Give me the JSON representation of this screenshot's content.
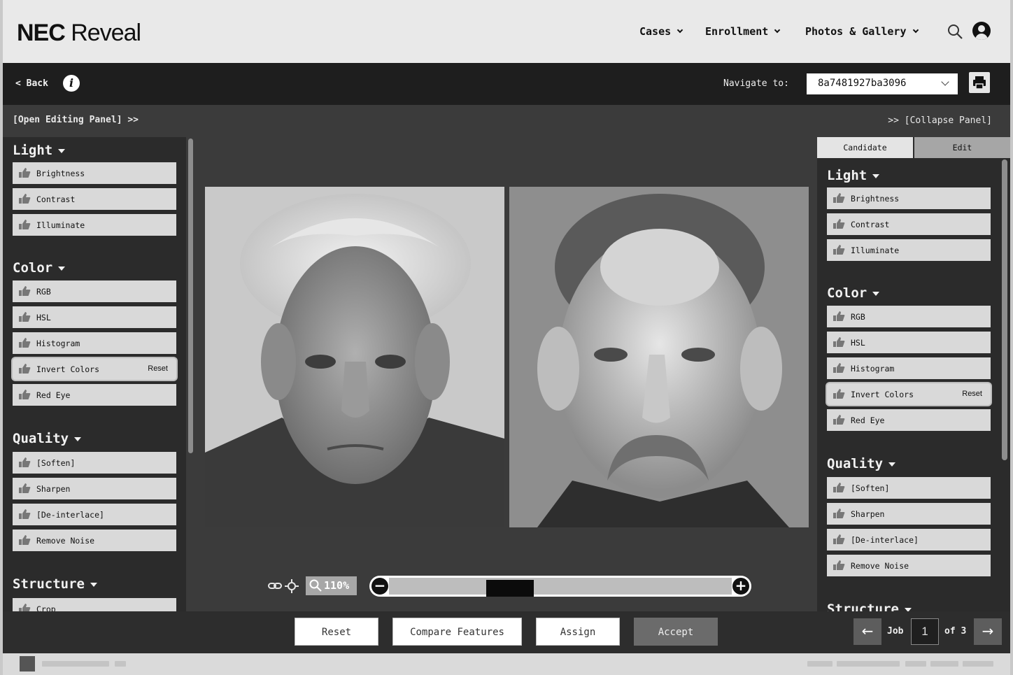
{
  "header": {
    "brand_bold": "NEC",
    "brand_light": "Reveal",
    "menus": [
      "Cases",
      "Enrollment",
      "Photos & Gallery"
    ]
  },
  "toolbar": {
    "back_label": "< Back",
    "info_label": "i",
    "navigate_label": "Navigate to:",
    "navigate_value": "8a7481927ba3096"
  },
  "panel_controls": {
    "open": "[Open Editing Panel] >>",
    "collapse": ">> [Collapse Panel]"
  },
  "left_panel": {
    "sections": [
      {
        "title": "Light",
        "tools": [
          "Brightness",
          "Contrast",
          "Illuminate"
        ]
      },
      {
        "title": "Color",
        "tools": [
          "RGB",
          "HSL",
          "Histogram",
          "Invert Colors",
          "Red Eye"
        ]
      },
      {
        "title": "Quality",
        "tools": [
          "[Soften]",
          "Sharpen",
          "[De-interlace]",
          "Remove Noise"
        ]
      },
      {
        "title": "Structure",
        "tools": [
          "Crop"
        ]
      }
    ],
    "reset_label": "Reset"
  },
  "right_panel": {
    "tabs": [
      "Candidate",
      "Edit"
    ],
    "active_tab": "Candidate",
    "sections": [
      {
        "title": "Light",
        "tools": [
          "Brightness",
          "Contrast",
          "Illuminate"
        ]
      },
      {
        "title": "Color",
        "tools": [
          "RGB",
          "HSL",
          "Histogram",
          "Invert Colors",
          "Red Eye"
        ]
      },
      {
        "title": "Quality",
        "tools": [
          "[Soften]",
          "Sharpen",
          "[De-interlace]",
          "Remove Noise"
        ]
      },
      {
        "title": "Structure",
        "tools": []
      }
    ],
    "reset_label": "Reset"
  },
  "viewer": {
    "zoom": "110%",
    "zoom_slider_position": 0.33
  },
  "actions": {
    "reset": "Reset",
    "compare": "Compare Features",
    "assign": "Assign",
    "accept": "Accept"
  },
  "pagination": {
    "job_label": "Job",
    "job_number": "1",
    "of_label": "of 3"
  },
  "colors": {
    "dark_bar": "#1e1e1e",
    "workspace": "#3b3b3b",
    "panel": "#2b2b2b",
    "tool_button": "#d9d9d9",
    "accept_button": "#6b6b6b"
  }
}
